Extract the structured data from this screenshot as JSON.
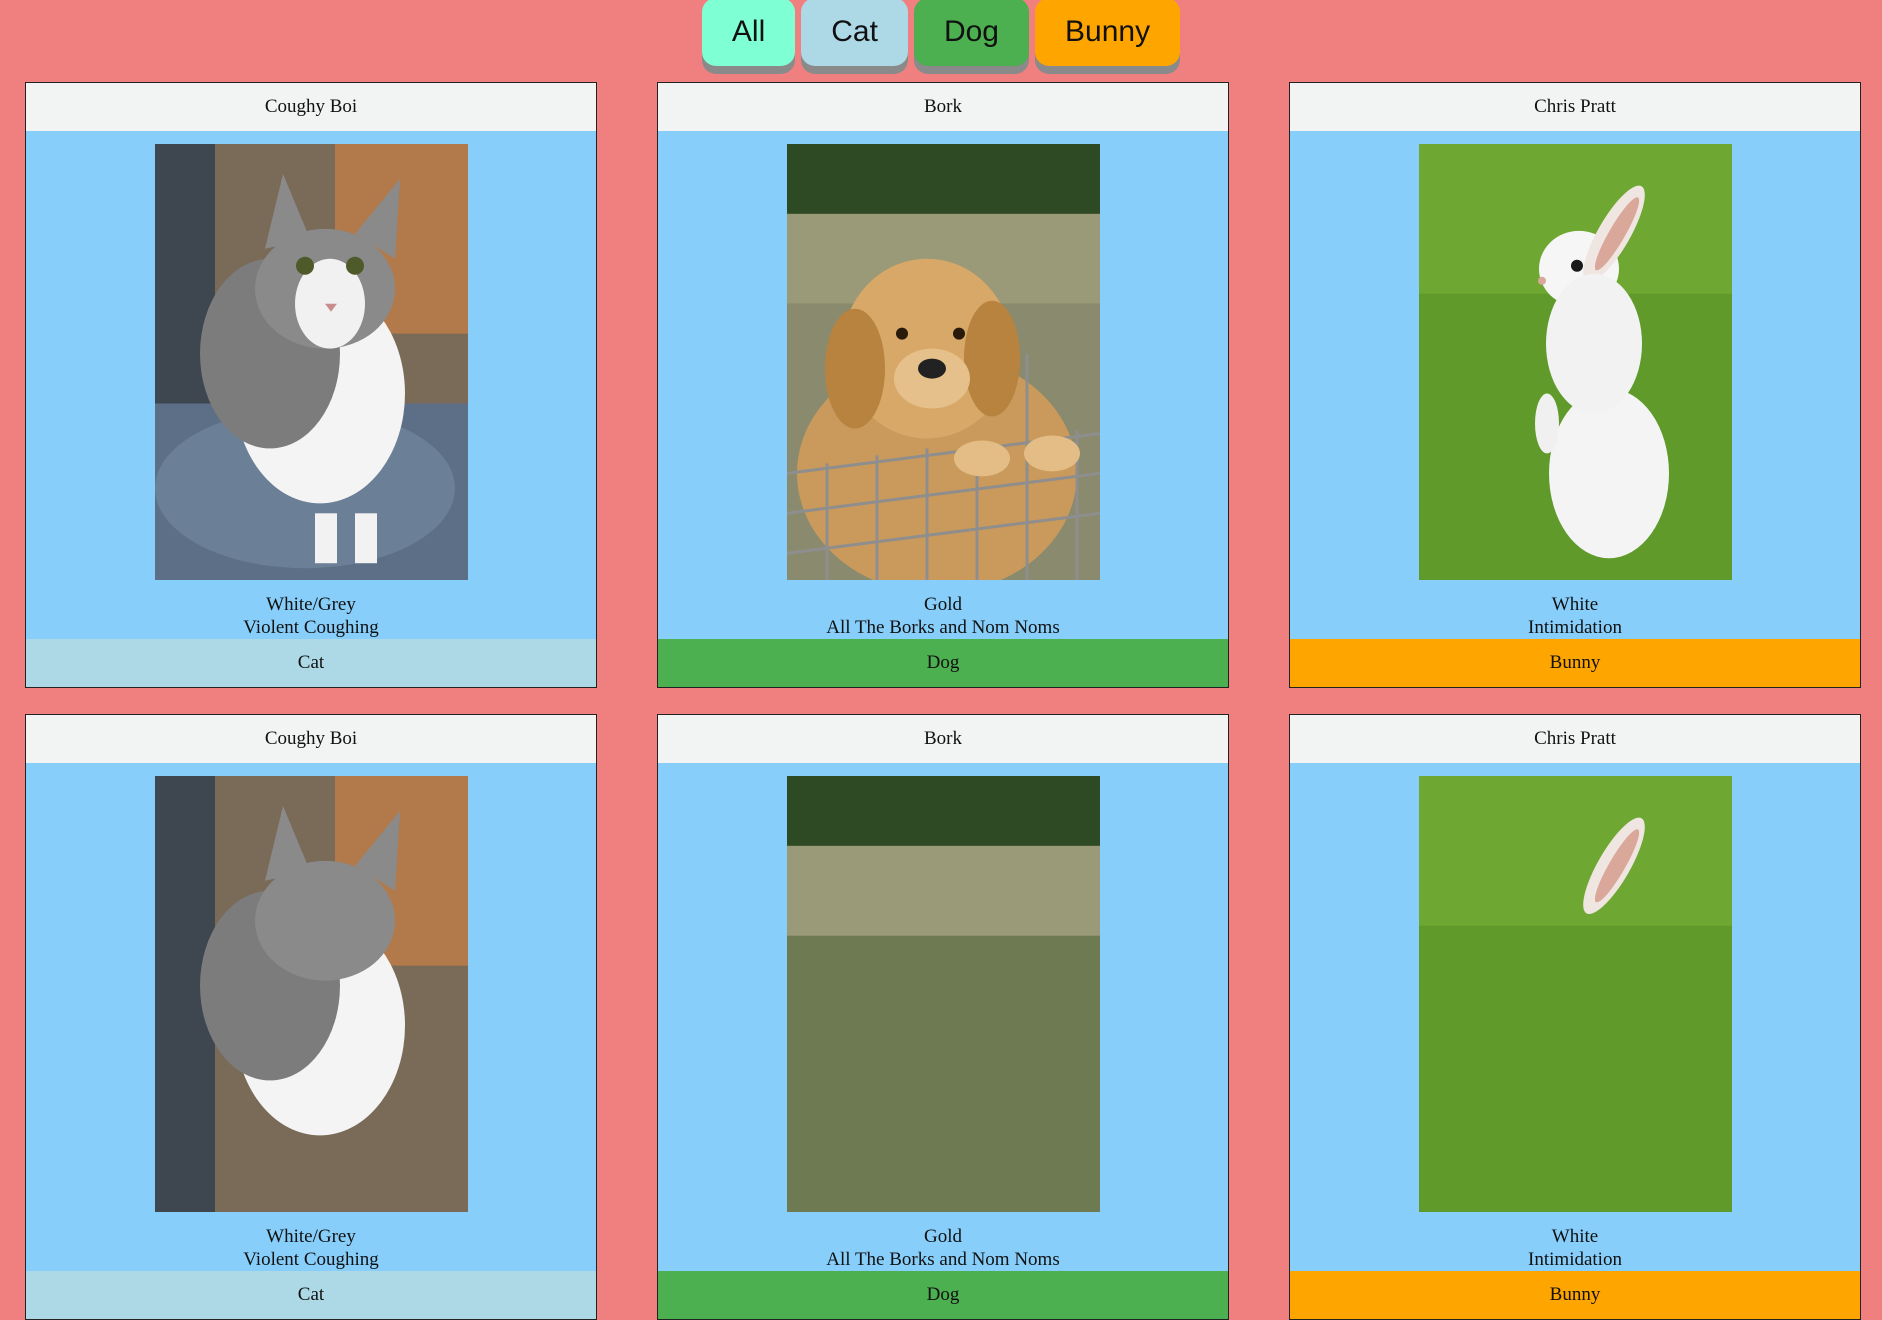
{
  "filters": [
    {
      "label": "All",
      "color": "#7fffd4"
    },
    {
      "label": "Cat",
      "color": "#add8e6"
    },
    {
      "label": "Dog",
      "color": "#4caf50"
    },
    {
      "label": "Bunny",
      "color": "#ffa500"
    }
  ],
  "cards": [
    {
      "name": "Coughy Boi",
      "color": "White/Grey",
      "trait": "Violent Coughing",
      "type": "Cat",
      "type_color": "#add8e6",
      "image": "cat-photo"
    },
    {
      "name": "Bork",
      "color": "Gold",
      "trait": "All The Borks and Nom Noms",
      "type": "Dog",
      "type_color": "#4caf50",
      "image": "dog-photo"
    },
    {
      "name": "Chris Pratt",
      "color": "White",
      "trait": "Intimidation",
      "type": "Bunny",
      "type_color": "#ffa500",
      "image": "bunny-photo"
    },
    {
      "name": "Coughy Boi",
      "color": "White/Grey",
      "trait": "Violent Coughing",
      "type": "Cat",
      "type_color": "#add8e6",
      "image": "cat-photo"
    },
    {
      "name": "Bork",
      "color": "Gold",
      "trait": "All The Borks and Nom Noms",
      "type": "Dog",
      "type_color": "#4caf50",
      "image": "dog-photo"
    },
    {
      "name": "Chris Pratt",
      "color": "White",
      "trait": "Intimidation",
      "type": "Bunny",
      "type_color": "#ffa500",
      "image": "bunny-photo"
    }
  ]
}
